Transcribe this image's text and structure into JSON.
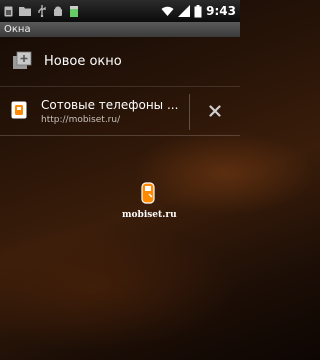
{
  "status_bar": {
    "time": "9:43",
    "left_icons": [
      "sim-icon",
      "folder-icon",
      "usb-icon",
      "android-debug-icon",
      "battery-small-icon"
    ],
    "right_icons": [
      "wifi-icon",
      "signal-icon",
      "battery-icon"
    ]
  },
  "title_bar": {
    "title": "Окна"
  },
  "new_window": {
    "label": "Новое окно",
    "icon": "new-window-icon"
  },
  "windows": [
    {
      "title": "Сотовые телефоны ...",
      "url": "http://mobiset.ru/",
      "icon": "site-favicon",
      "close_icon": "close-icon"
    }
  ],
  "watermark": {
    "text": "mobiset.ru"
  },
  "colors": {
    "accent": "#ff8a00",
    "status_bg": "#111111",
    "title_bg": "#4a4a4a"
  }
}
